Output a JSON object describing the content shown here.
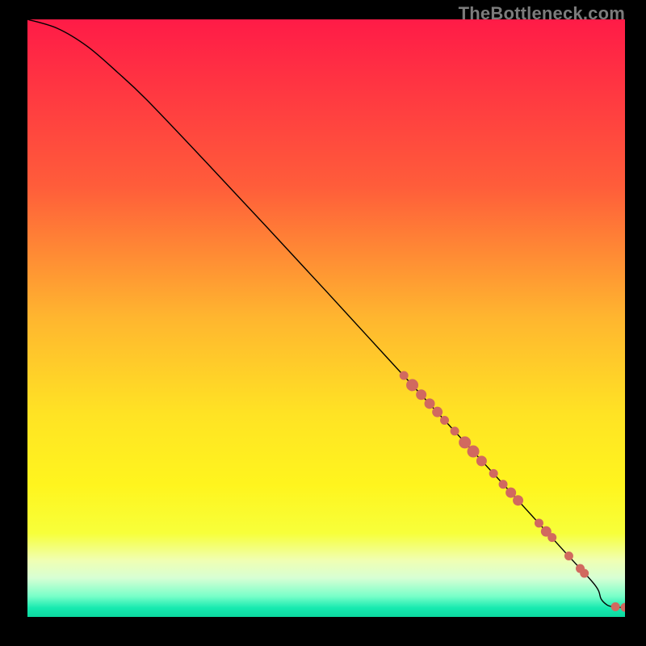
{
  "watermark": "TheBottleneck.com",
  "colors": {
    "curve": "#000000",
    "marker_fill": "#d1695f",
    "marker_stroke": "#d1695f",
    "background_black": "#000000"
  },
  "gradient_stops": [
    {
      "offset": 0.0,
      "color": "#ff1b47"
    },
    {
      "offset": 0.28,
      "color": "#ff5d3a"
    },
    {
      "offset": 0.5,
      "color": "#ffb62f"
    },
    {
      "offset": 0.66,
      "color": "#ffe324"
    },
    {
      "offset": 0.78,
      "color": "#fff51e"
    },
    {
      "offset": 0.86,
      "color": "#f7ff3a"
    },
    {
      "offset": 0.905,
      "color": "#f0ffb2"
    },
    {
      "offset": 0.935,
      "color": "#d7ffd4"
    },
    {
      "offset": 0.965,
      "color": "#7affc9"
    },
    {
      "offset": 0.985,
      "color": "#17eab0"
    },
    {
      "offset": 1.0,
      "color": "#0cd89f"
    }
  ],
  "chart_data": {
    "type": "line",
    "title": "",
    "xlabel": "",
    "ylabel": "",
    "xlim": [
      0,
      100
    ],
    "ylim": [
      0,
      100
    ],
    "series": [
      {
        "name": "curve",
        "x": [
          0,
          5,
          10,
          15,
          20,
          30,
          40,
          50,
          60,
          70,
          80,
          90,
          95,
          96,
          97,
          98,
          99,
          100
        ],
        "y": [
          100,
          98.5,
          95.5,
          91.2,
          86.5,
          76.0,
          65.3,
          54.5,
          43.6,
          32.7,
          21.8,
          10.8,
          5.3,
          3.0,
          2.0,
          1.7,
          1.6,
          1.6
        ]
      }
    ],
    "scatter": [
      {
        "x": 63.0,
        "y": 40.4,
        "r": 5
      },
      {
        "x": 64.4,
        "y": 38.8,
        "r": 7
      },
      {
        "x": 65.9,
        "y": 37.2,
        "r": 6
      },
      {
        "x": 67.3,
        "y": 35.7,
        "r": 6
      },
      {
        "x": 68.6,
        "y": 34.3,
        "r": 6
      },
      {
        "x": 69.8,
        "y": 32.9,
        "r": 5
      },
      {
        "x": 71.5,
        "y": 31.1,
        "r": 5
      },
      {
        "x": 73.2,
        "y": 29.2,
        "r": 7
      },
      {
        "x": 74.6,
        "y": 27.7,
        "r": 7
      },
      {
        "x": 76.0,
        "y": 26.1,
        "r": 6
      },
      {
        "x": 78.0,
        "y": 24.0,
        "r": 5
      },
      {
        "x": 79.6,
        "y": 22.2,
        "r": 5
      },
      {
        "x": 80.9,
        "y": 20.8,
        "r": 6
      },
      {
        "x": 82.1,
        "y": 19.5,
        "r": 6
      },
      {
        "x": 85.6,
        "y": 15.7,
        "r": 5
      },
      {
        "x": 86.8,
        "y": 14.3,
        "r": 6
      },
      {
        "x": 87.8,
        "y": 13.3,
        "r": 5
      },
      {
        "x": 90.6,
        "y": 10.2,
        "r": 5
      },
      {
        "x": 92.5,
        "y": 8.1,
        "r": 5
      },
      {
        "x": 93.2,
        "y": 7.3,
        "r": 5
      },
      {
        "x": 98.4,
        "y": 1.7,
        "r": 5
      },
      {
        "x": 100.0,
        "y": 1.6,
        "r": 5
      }
    ]
  }
}
